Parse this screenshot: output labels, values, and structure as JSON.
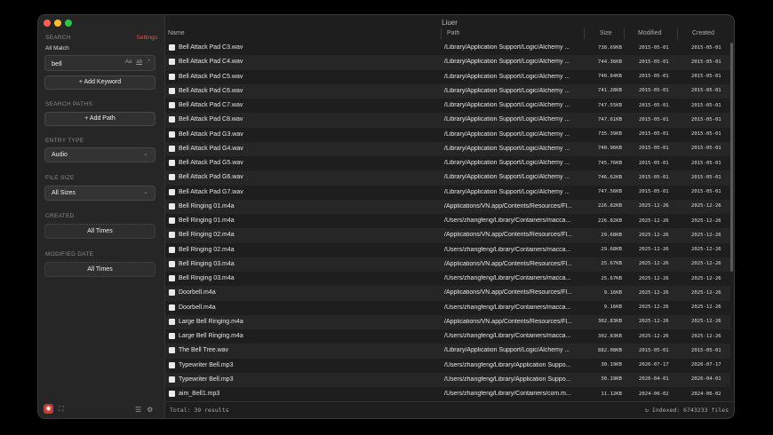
{
  "window": {
    "title": "Liuer"
  },
  "colors": {
    "close": "#ff5f57",
    "minimize": "#febc2e",
    "zoom": "#28c840",
    "accent": "#e0564f"
  },
  "sidebar": {
    "search_label": "SEARCH",
    "settings_link": "Settings",
    "match_mode": "All Match",
    "query": "bell",
    "query_options": [
      "Aa",
      "ab",
      ".*"
    ],
    "add_keyword": "+ Add Keyword",
    "search_paths_label": "SEARCH PATHS",
    "add_path": "+ Add Path",
    "entry_type_label": "ENTRY TYPE",
    "entry_type_value": "Audio",
    "file_size_label": "FILE SIZE",
    "file_size_value": "All Sizes",
    "created_label": "CREATED",
    "created_value": "All Times",
    "modified_label": "MODIFIED DATE",
    "modified_value": "All Times"
  },
  "table": {
    "headers": {
      "name": "Name",
      "path": "Path",
      "size": "Size",
      "modified": "Modified",
      "created": "Created"
    },
    "rows": [
      {
        "name": "Bell Attack Pad C3.wav",
        "path": "/Library/Application Support/Logic/Alchemy ...",
        "size": "738.69KB",
        "modified": "2015-05-01",
        "created": "2015-05-01"
      },
      {
        "name": "Bell Attack Pad C4.wav",
        "path": "/Library/Application Support/Logic/Alchemy ...",
        "size": "744.36KB",
        "modified": "2015-05-01",
        "created": "2015-05-01"
      },
      {
        "name": "Bell Attack Pad C5.wav",
        "path": "/Library/Application Support/Logic/Alchemy ...",
        "size": "740.84KB",
        "modified": "2015-05-01",
        "created": "2015-05-01"
      },
      {
        "name": "Bell Attack Pad C6.wav",
        "path": "/Library/Application Support/Logic/Alchemy ...",
        "size": "741.28KB",
        "modified": "2015-05-01",
        "created": "2015-05-01"
      },
      {
        "name": "Bell Attack Pad C7.wav",
        "path": "/Library/Application Support/Logic/Alchemy ...",
        "size": "747.55KB",
        "modified": "2015-05-01",
        "created": "2015-05-01"
      },
      {
        "name": "Bell Attack Pad C8.wav",
        "path": "/Library/Application Support/Logic/Alchemy ...",
        "size": "747.61KB",
        "modified": "2015-05-01",
        "created": "2015-05-01"
      },
      {
        "name": "Bell Attack Pad G3.wav",
        "path": "/Library/Application Support/Logic/Alchemy ...",
        "size": "735.39KB",
        "modified": "2015-05-01",
        "created": "2015-05-01"
      },
      {
        "name": "Bell Attack Pad G4.wav",
        "path": "/Library/Application Support/Logic/Alchemy ...",
        "size": "740.96KB",
        "modified": "2015-05-01",
        "created": "2015-05-01"
      },
      {
        "name": "Bell Attack Pad G5.wav",
        "path": "/Library/Application Support/Logic/Alchemy ...",
        "size": "745.76KB",
        "modified": "2015-05-01",
        "created": "2015-05-01"
      },
      {
        "name": "Bell Attack Pad G6.wav",
        "path": "/Library/Application Support/Logic/Alchemy ...",
        "size": "746.62KB",
        "modified": "2015-05-01",
        "created": "2015-05-01"
      },
      {
        "name": "Bell Attack Pad G7.wav",
        "path": "/Library/Application Support/Logic/Alchemy ...",
        "size": "747.56KB",
        "modified": "2015-05-01",
        "created": "2015-05-01"
      },
      {
        "name": "Bell Ringing 01.m4a",
        "path": "/Applications/VN.app/Contents/Resources/Fl...",
        "size": "226.82KB",
        "modified": "2025-12-26",
        "created": "2025-12-26"
      },
      {
        "name": "Bell Ringing 01.m4a",
        "path": "/Users/zhangfeng/Library/Containers/macca...",
        "size": "226.82KB",
        "modified": "2025-12-26",
        "created": "2025-12-26"
      },
      {
        "name": "Bell Ringing 02.m4a",
        "path": "/Applications/VN.app/Contents/Resources/Fl...",
        "size": "29.68KB",
        "modified": "2025-12-26",
        "created": "2025-12-26"
      },
      {
        "name": "Bell Ringing 02.m4a",
        "path": "/Users/zhangfeng/Library/Containers/macca...",
        "size": "29.68KB",
        "modified": "2025-12-26",
        "created": "2025-12-26"
      },
      {
        "name": "Bell Ringing 03.m4a",
        "path": "/Applications/VN.app/Contents/Resources/Fl...",
        "size": "25.67KB",
        "modified": "2025-12-26",
        "created": "2025-12-26"
      },
      {
        "name": "Bell Ringing 03.m4a",
        "path": "/Users/zhangfeng/Library/Containers/macca...",
        "size": "25.67KB",
        "modified": "2025-12-26",
        "created": "2025-12-26"
      },
      {
        "name": "Doorbell.m4a",
        "path": "/Applications/VN.app/Contents/Resources/Fl...",
        "size": "9.16KB",
        "modified": "2025-12-26",
        "created": "2025-12-26"
      },
      {
        "name": "Doorbell.m4a",
        "path": "/Users/zhangfeng/Library/Containers/macca...",
        "size": "9.16KB",
        "modified": "2025-12-26",
        "created": "2025-12-26"
      },
      {
        "name": "Large Bell Ringing.m4a",
        "path": "/Applications/VN.app/Contents/Resources/Fl...",
        "size": "302.83KB",
        "modified": "2025-12-26",
        "created": "2025-12-26"
      },
      {
        "name": "Large Bell Ringing.m4a",
        "path": "/Users/zhangfeng/Library/Containers/macca...",
        "size": "302.83KB",
        "modified": "2025-12-26",
        "created": "2025-12-26"
      },
      {
        "name": "The Bell Tree.wav",
        "path": "/Library/Application Support/Logic/Alchemy ...",
        "size": "882.08KB",
        "modified": "2015-05-01",
        "created": "2015-05-01"
      },
      {
        "name": "Typewriter Bell.mp3",
        "path": "/Users/zhangfeng/Library/Application Suppo...",
        "size": "30.19KB",
        "modified": "2026-07-17",
        "created": "2026-07-17"
      },
      {
        "name": "Typewriter Bell.mp3",
        "path": "/Users/zhangfeng/Library/Application Suppo...",
        "size": "30.19KB",
        "modified": "2026-04-01",
        "created": "2026-04-01"
      },
      {
        "name": "aim_Bell1.mp3",
        "path": "/Users/zhangfeng/Library/Containers/com.m...",
        "size": "11.12KB",
        "modified": "2024-06-02",
        "created": "2024-06-02"
      }
    ]
  },
  "footer": {
    "total": "Total: 39 results",
    "indexed": "Indexed: 6743233 files"
  },
  "icons": {
    "app": "app-logo-icon",
    "selection": "selection-icon",
    "list": "list-icon",
    "settings": "gear-icon",
    "refresh": "refresh-icon"
  }
}
